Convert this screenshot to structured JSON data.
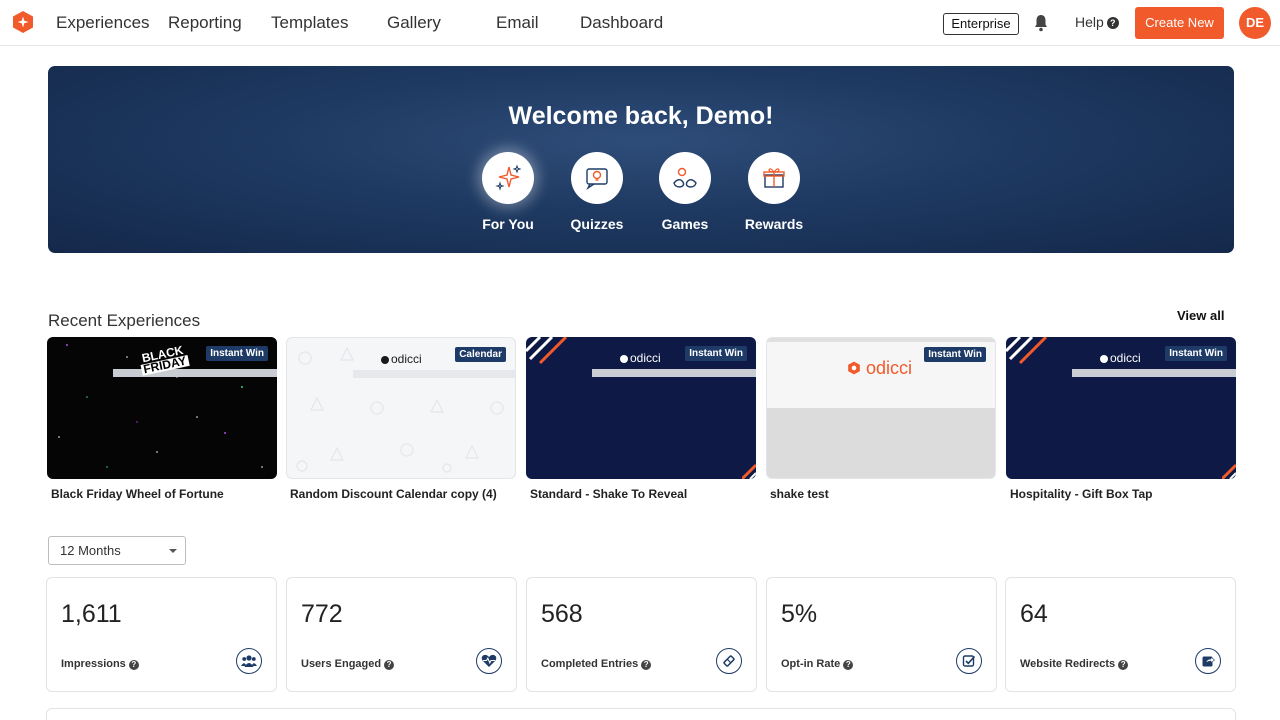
{
  "nav": {
    "items": [
      "Experiences",
      "Reporting",
      "Templates",
      "Gallery",
      "Email",
      "Dashboard"
    ],
    "enterprise_label": "Enterprise",
    "help_label": "Help",
    "create_label": "Create New",
    "avatar_initials": "DE"
  },
  "hero": {
    "title": "Welcome back, Demo!",
    "categories": [
      {
        "label": "For You",
        "icon": "sparkle-icon"
      },
      {
        "label": "Quizzes",
        "icon": "quiz-icon"
      },
      {
        "label": "Games",
        "icon": "games-icon"
      },
      {
        "label": "Rewards",
        "icon": "gift-icon"
      }
    ]
  },
  "recent": {
    "title": "Recent Experiences",
    "view_all": "View all",
    "cards": [
      {
        "title": "Black Friday Wheel of Fortune",
        "badge": "Instant Win",
        "thumb_text_1": "BLACK",
        "thumb_text_2": "FRIDAY"
      },
      {
        "title": "Random Discount Calendar copy (4)",
        "badge": "Calendar",
        "brand": "odicci"
      },
      {
        "title": "Standard - Shake To Reveal",
        "badge": "Instant Win",
        "brand": "odicci"
      },
      {
        "title": "shake test",
        "badge": "Instant Win",
        "brand": "odicci"
      },
      {
        "title": "Hospitality - Gift Box Tap",
        "badge": "Instant Win",
        "brand": "odicci"
      }
    ]
  },
  "filter": {
    "selected": "12 Months"
  },
  "stats": [
    {
      "value": "1,611",
      "label": "Impressions",
      "icon": "users-group-icon"
    },
    {
      "value": "772",
      "label": "Users Engaged",
      "icon": "heart-pulse-icon"
    },
    {
      "value": "568",
      "label": "Completed Entries",
      "icon": "ticket-icon"
    },
    {
      "value": "5%",
      "label": "Opt-in Rate",
      "icon": "checkbox-icon"
    },
    {
      "value": "64",
      "label": "Website Redirects",
      "icon": "share-icon"
    }
  ],
  "colors": {
    "accent": "#f15a2b",
    "navy": "#1d3b66",
    "hero_dark": "#14284a"
  }
}
